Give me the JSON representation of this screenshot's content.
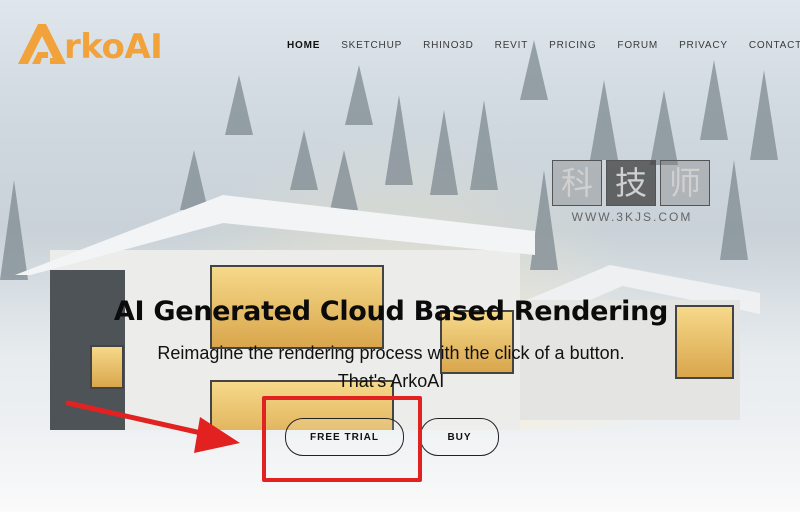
{
  "brand": {
    "name": "ArkoAI",
    "logo_text": "rkoAI",
    "accent_color": "#f2a23a"
  },
  "nav": {
    "items": [
      {
        "label": "HOME",
        "active": true
      },
      {
        "label": "SKETCHUP",
        "active": false
      },
      {
        "label": "RHINO3D",
        "active": false
      },
      {
        "label": "REVIT",
        "active": false
      },
      {
        "label": "PRICING",
        "active": false
      },
      {
        "label": "FORUM",
        "active": false
      },
      {
        "label": "PRIVACY",
        "active": false
      },
      {
        "label": "CONTACT",
        "active": false
      }
    ]
  },
  "hero": {
    "headline": "AI Generated Cloud Based Rendering",
    "subtitle_line1": "Reimagine the rendering process with the click of a button.",
    "subtitle_line2": "That's ArkoAI",
    "buttons": {
      "free_trial": "FREE TRIAL",
      "buy": "BUY"
    }
  },
  "watermark": {
    "chars": [
      "科",
      "技",
      "师"
    ],
    "url": "WWW.3KJS.COM"
  },
  "annotation": {
    "highlight_color": "#e22121",
    "target": "free-trial-button"
  }
}
